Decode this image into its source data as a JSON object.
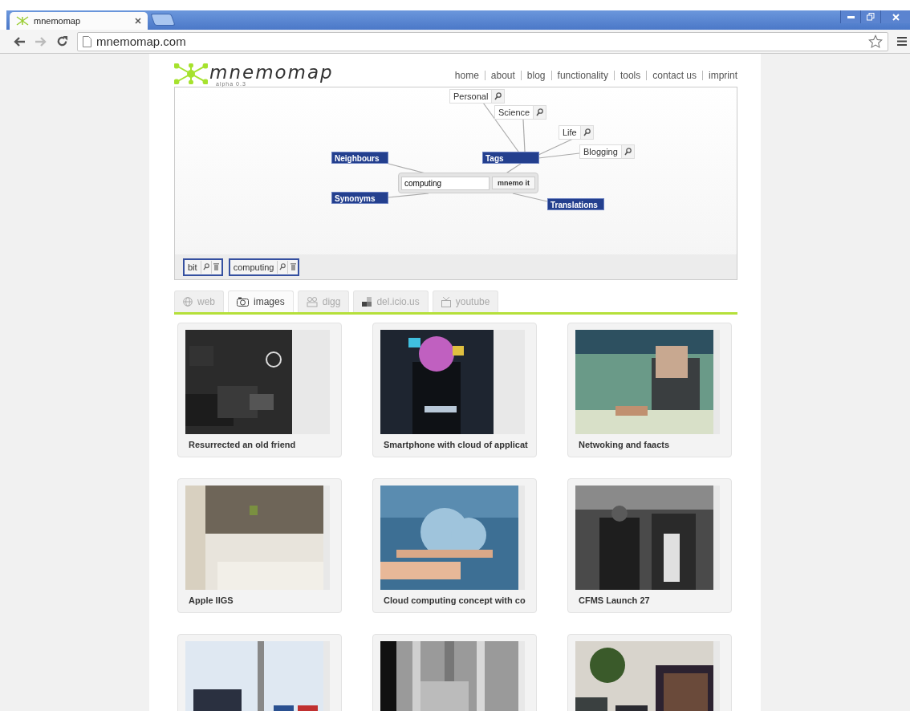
{
  "browser": {
    "tabs": [
      {
        "title": "mnemomap",
        "selected": true
      }
    ],
    "url": "mnemomap.com"
  },
  "site": {
    "logo": {
      "name": "mnemomap",
      "version": "alpha 0.3"
    },
    "nav": [
      "home",
      "about",
      "blog",
      "functionality",
      "tools",
      "contact us",
      "imprint"
    ],
    "mindmap": {
      "query": "computing",
      "button": "mnemo it",
      "categories": [
        {
          "label": "Neighbours"
        },
        {
          "label": "Tags",
          "children": [
            {
              "label": "Personal"
            },
            {
              "label": "Science"
            },
            {
              "label": "Life"
            },
            {
              "label": "Blogging"
            }
          ]
        },
        {
          "label": "Synonyms"
        },
        {
          "label": "Translations"
        }
      ],
      "history": [
        {
          "label": "bit"
        },
        {
          "label": "computing"
        }
      ]
    },
    "source_tabs": [
      {
        "label": "web",
        "selected": false
      },
      {
        "label": "images",
        "selected": true
      },
      {
        "label": "digg",
        "selected": false
      },
      {
        "label": "del.icio.us",
        "selected": false
      },
      {
        "label": "youtube",
        "selected": false
      }
    ],
    "results": [
      {
        "kind": "picture",
        "caption": "Resurrected an old friend"
      },
      {
        "kind": "picture",
        "caption": "Smartphone with cloud of applicat"
      },
      {
        "kind": "picture",
        "caption": "Netwoking and faacts"
      },
      {
        "kind": "picture",
        "caption": "Apple IIGS"
      },
      {
        "kind": "picture",
        "caption": "Cloud computing concept with co"
      },
      {
        "kind": "picture",
        "caption": "CFMS Launch 27"
      },
      {
        "kind": "picture"
      },
      {
        "kind": "picture"
      },
      {
        "kind": "picture"
      }
    ]
  }
}
